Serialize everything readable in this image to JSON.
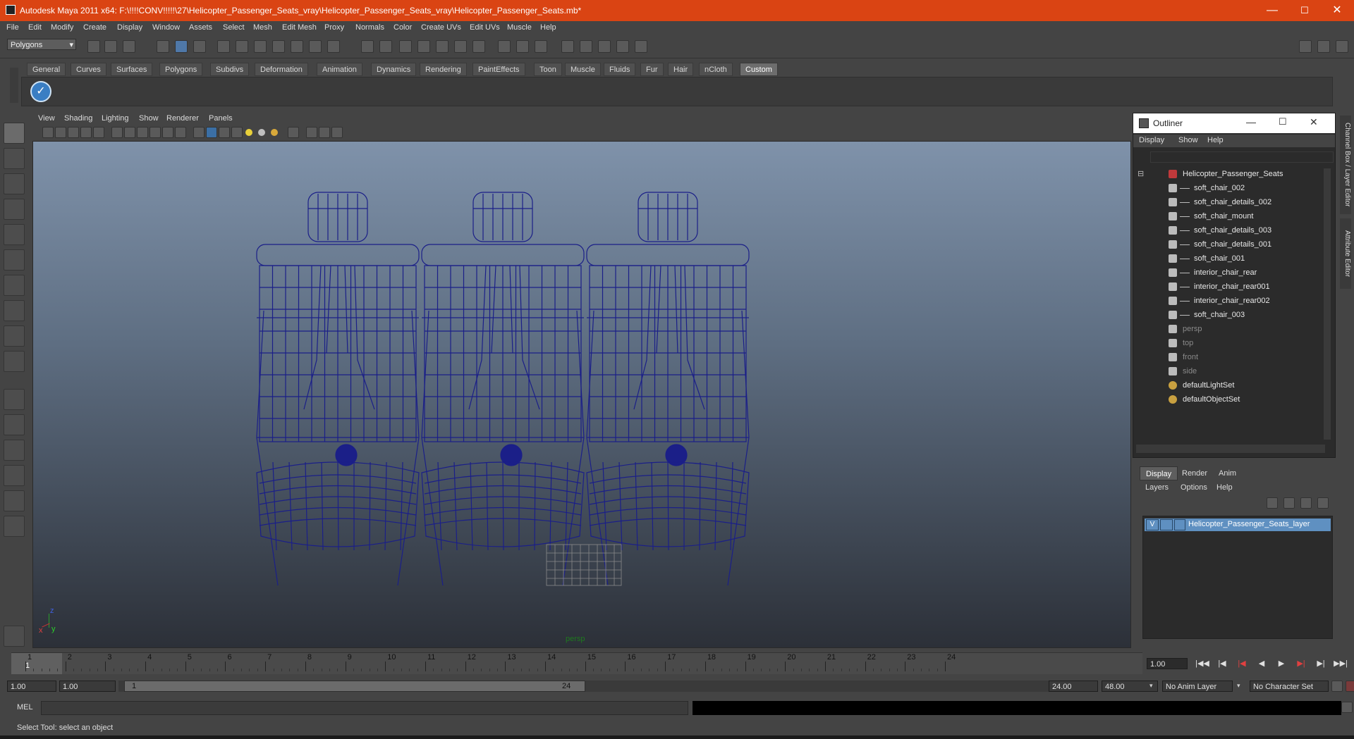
{
  "window": {
    "title": "Autodesk Maya 2011 x64: F:\\!!!!CONV!!!!!\\27\\Helicopter_Passenger_Seats_vray\\Helicopter_Passenger_Seats_vray\\Helicopter_Passenger_Seats.mb*",
    "controls": [
      "—",
      "☐",
      "✕"
    ]
  },
  "menubar": {
    "items": [
      "File",
      "Edit",
      "Modify",
      "Create",
      "Display",
      "Window",
      "Assets",
      "Select",
      "Mesh",
      "Edit Mesh",
      "Proxy",
      "Normals",
      "Color",
      "Create UVs",
      "Edit UVs",
      "Muscle",
      "Help"
    ]
  },
  "statusline": {
    "mode": "Polygons"
  },
  "shelf": {
    "tabs": [
      "General",
      "Curves",
      "Surfaces",
      "Polygons",
      "Subdivs",
      "Deformation",
      "Animation",
      "Dynamics",
      "Rendering",
      "PaintEffects",
      "Toon",
      "Muscle",
      "Fluids",
      "Fur",
      "Hair",
      "nCloth",
      "Custom"
    ],
    "active_tab": "Custom"
  },
  "viewport": {
    "menu": [
      "View",
      "Shading",
      "Lighting",
      "Show",
      "Renderer",
      "Panels"
    ],
    "camera_label": "persp",
    "axis": {
      "z": "z",
      "y": "y",
      "x": "x"
    },
    "wire_color": "#1b1f88"
  },
  "outliner": {
    "title": "Outliner",
    "menu": [
      "Display",
      "Show",
      "Help"
    ],
    "items": [
      {
        "label": "Helicopter_Passenger_Seats",
        "type": "group",
        "dim": false
      },
      {
        "label": "soft_chair_002",
        "type": "mesh",
        "dim": false
      },
      {
        "label": "soft_chair_details_002",
        "type": "mesh",
        "dim": false
      },
      {
        "label": "soft_chair_mount",
        "type": "mesh",
        "dim": false
      },
      {
        "label": "soft_chair_details_003",
        "type": "mesh",
        "dim": false
      },
      {
        "label": "soft_chair_details_001",
        "type": "mesh",
        "dim": false
      },
      {
        "label": "soft_chair_001",
        "type": "mesh",
        "dim": false
      },
      {
        "label": "interior_chair_rear",
        "type": "mesh",
        "dim": false
      },
      {
        "label": "interior_chair_rear001",
        "type": "mesh",
        "dim": false
      },
      {
        "label": "interior_chair_rear002",
        "type": "mesh",
        "dim": false
      },
      {
        "label": "soft_chair_003",
        "type": "mesh",
        "dim": false
      },
      {
        "label": "persp",
        "type": "camera",
        "dim": true
      },
      {
        "label": "top",
        "type": "camera",
        "dim": true
      },
      {
        "label": "front",
        "type": "camera",
        "dim": true
      },
      {
        "label": "side",
        "type": "camera",
        "dim": true
      },
      {
        "label": "defaultLightSet",
        "type": "set",
        "dim": false
      },
      {
        "label": "defaultObjectSet",
        "type": "set",
        "dim": false
      }
    ]
  },
  "side_tabs": [
    "Channel Box / Layer Editor",
    "Attribute Editor"
  ],
  "layer_editor": {
    "tabs": [
      "Display",
      "Render",
      "Anim"
    ],
    "active_tab": "Display",
    "menu": [
      "Layers",
      "Options",
      "Help"
    ],
    "layer": {
      "visible": "V",
      "name": "Helicopter_Passenger_Seats_layer",
      "color": "#5f90c1"
    }
  },
  "timeline": {
    "ticks": [
      "1",
      "2",
      "3",
      "4",
      "5",
      "6",
      "7",
      "8",
      "9",
      "10",
      "11",
      "12",
      "13",
      "14",
      "15",
      "16",
      "17",
      "18",
      "19",
      "20",
      "21",
      "22",
      "23",
      "24"
    ],
    "current_frame": "1",
    "current_time_field": "1.00"
  },
  "range": {
    "start_time": "1.00",
    "playback_start": "1.00",
    "slider_start": "1",
    "slider_end": "24",
    "playback_end": "24.00",
    "end_time": "48.00",
    "anim_layer": "No Anim Layer",
    "character_set": "No Character Set"
  },
  "cmdline": {
    "label": "MEL"
  },
  "helpline": {
    "text": "Select Tool: select an object"
  }
}
